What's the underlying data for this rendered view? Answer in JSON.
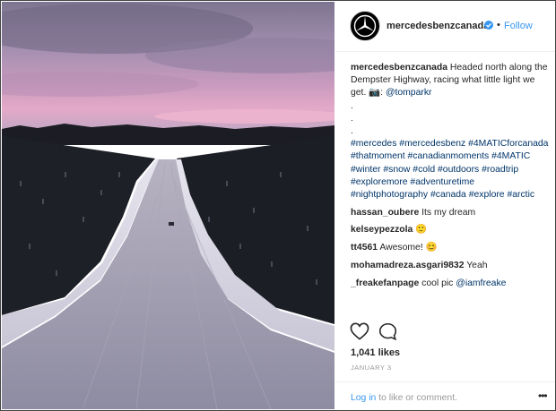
{
  "post": {
    "photo_alt": "",
    "account": {
      "username": "mercedesbenzcanada",
      "verified_icon": "verified-badge-icon",
      "separator": "•",
      "follow_label": "Follow"
    },
    "caption": {
      "username": "mercedesbenzcanada",
      "text": " Headed north along the Dempster Highway, racing what little light we get. 📷: ",
      "mention": "@tomparkr",
      "dots": [
        ".",
        ".",
        "."
      ],
      "hashtags": "#mercedes #mercedesbenz #4MATICforcanada #thatmoment #canadianmoments #4MATIC #winter #snow #cold #outdoors #roadtrip #exploremore #adventuretime #nightphotography #canada #explore #arctic"
    },
    "comments": [
      {
        "user": "hassan_oubere",
        "text": " Its my dream"
      },
      {
        "user": "kelseypezzola",
        "text": " 🙂"
      },
      {
        "user": "tt4561",
        "text": " Awesome! 😊"
      },
      {
        "user": "mohamadreza.asgari9832",
        "text": " Yeah"
      },
      {
        "user": "_freakefanpage",
        "text": " cool pic ",
        "mention": "@iamfreake"
      }
    ],
    "likes": "1,041 likes",
    "date": "JANUARY 3",
    "footer": {
      "login_link": "Log in",
      "login_rest": " to like or comment.",
      "more_label": "•••"
    },
    "colors": {
      "link": "#3897f0",
      "text": "#262626",
      "muted": "#999999",
      "sky_top": "#8a7f9e",
      "sky_pink": "#d59ac4"
    }
  }
}
